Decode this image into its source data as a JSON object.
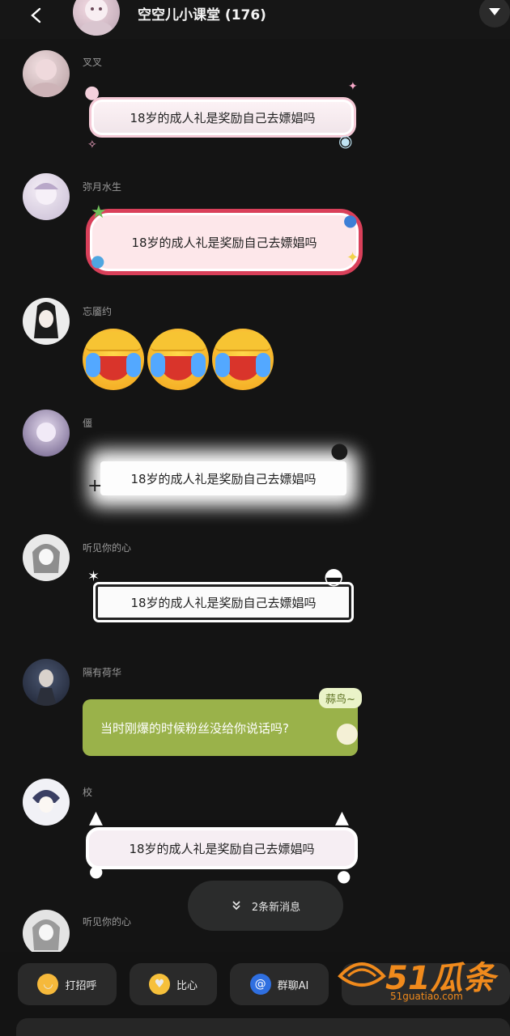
{
  "header": {
    "title": "空空儿小课堂 (176)"
  },
  "messages": [
    {
      "sender": "叉叉",
      "text": "18岁的成人礼是奖励自己去嫖娼吗"
    },
    {
      "sender": "弥月水生",
      "text": "18岁的成人礼是奖励自己去嫖娼吗"
    },
    {
      "sender": "忘靥约",
      "emoji_count": 3,
      "emoji": "crying-face"
    },
    {
      "sender": "僵",
      "text": "18岁的成人礼是奖励自己去嫖娼吗"
    },
    {
      "sender": "听见你的心",
      "text": "18岁的成人礼是奖励自己去嫖娼吗"
    },
    {
      "sender": "隔有荷华",
      "text": "当时刚爆的时候粉丝没给你说话吗?",
      "tag": "蒜鸟~"
    },
    {
      "sender": "校",
      "text": "18岁的成人礼是奖励自己去嫖娼吗"
    },
    {
      "sender": "听见你的心"
    }
  ],
  "new_messages": {
    "label": "2条新消息"
  },
  "quick_actions": [
    {
      "label": "打招呼",
      "icon": "wave-emoji-icon"
    },
    {
      "label": "比心",
      "icon": "heart-hands-emoji-icon"
    },
    {
      "label": "群聊AI",
      "icon": "at-icon"
    }
  ],
  "watermark": {
    "brand": "51瓜条",
    "site": "51guatiao.com"
  },
  "colors": {
    "background": "#141414",
    "bubble_green": "#9ab24a",
    "accent_red": "#d9405a"
  }
}
